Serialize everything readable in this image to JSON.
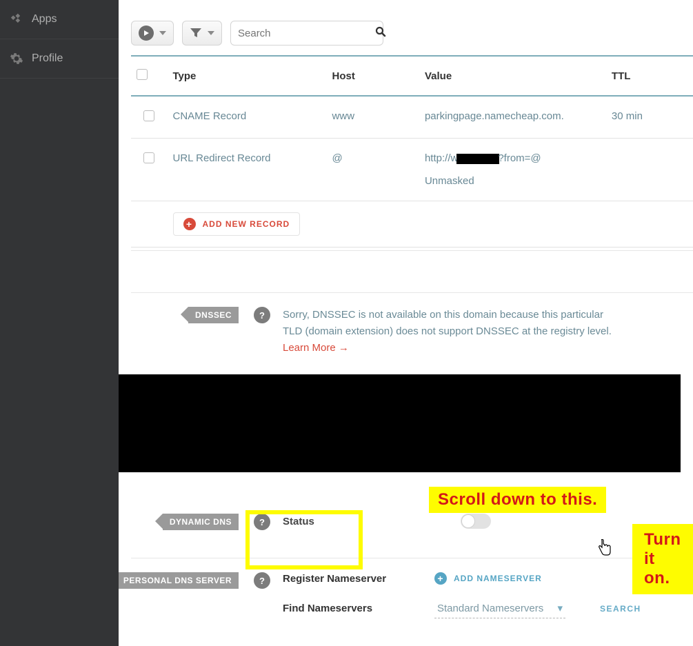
{
  "sidebar": {
    "items": [
      {
        "label": "Apps",
        "icon": "apps"
      },
      {
        "label": "Profile",
        "icon": "gear"
      }
    ]
  },
  "toolbar": {
    "play_label": "",
    "filter_label": "",
    "search_placeholder": "Search"
  },
  "records_table": {
    "headers": {
      "type": "Type",
      "host": "Host",
      "value": "Value",
      "ttl": "TTL"
    },
    "rows": [
      {
        "type": "CNAME Record",
        "host": "www",
        "value": "parkingpage.namecheap.com.",
        "ttl": "30 min"
      },
      {
        "type": "URL Redirect Record",
        "host": "@",
        "value_pre": "http://w",
        "value_post": "?from=@",
        "value_line2": "Unmasked",
        "ttl": ""
      }
    ],
    "add_label": "ADD NEW RECORD"
  },
  "dnssec": {
    "tag": "DNSSEC",
    "text": "Sorry, DNSSEC is not available on this domain because this particular TLD (domain extension) does not support DNSSEC at the registry level. ",
    "link": "Learn More →"
  },
  "dynamic_dns": {
    "tag": "DYNAMIC DNS",
    "status_label": "Status"
  },
  "personal_dns": {
    "tag": "PERSONAL DNS SERVER",
    "register_label": "Register Nameserver",
    "add_ns_label": "ADD NAMESERVER",
    "find_label": "Find Nameservers",
    "select_value": "Standard Nameservers",
    "search_label": "SEARCH"
  },
  "annotations": {
    "scroll": "Scroll down to this.",
    "turn_on": "Turn it on."
  }
}
